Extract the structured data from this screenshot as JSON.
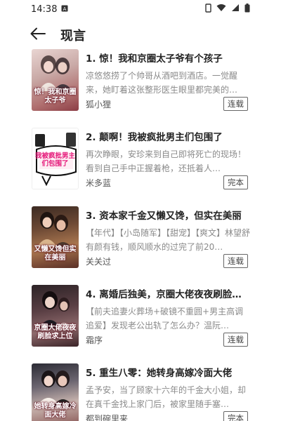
{
  "status_bar": {
    "time": "14:38",
    "icons": [
      "notification-a-icon",
      "sim-icon",
      "wifi-icon",
      "signal-icon",
      "battery-icon"
    ]
  },
  "header": {
    "back_icon": "arrow-left-icon",
    "title": "现言"
  },
  "books": [
    {
      "title": "1. 惊！我和京圈太子爷有个孩子",
      "description": "凉悠悠捞了个帅哥从酒吧到酒店。一觉醒来，她盯着这张整形医生眼里都完美的…",
      "author": "狐小狸",
      "status": "连载",
      "cover_text": "惊！我和京圈太子爷"
    },
    {
      "title": "2. 颠啊！我被疯批男主们包围了",
      "description": "再次睁眼，安珍来到自己即将死亡的现场！看到自己手中正握着枪，还抵着人…",
      "author": "米多蓝",
      "status": "完本",
      "cover_text": "我被疯批男主们包围了"
    },
    {
      "title": "3. 资本家千金又懒又馋，但实在美丽",
      "description": "【年代】【小岛随军】【甜宠】【爽文】林望舒有颜有钱，顺风顺水的过完了前20…",
      "author": "关关过",
      "status": "连载",
      "cover_text": "又懒又馋但实在美丽"
    },
    {
      "title": "4. 离婚后独美，京圈大佬夜夜刷脸…",
      "description": "【前夫追妻火葬场+破镜不重圆+男主高调追爱】发现老公出轨了怎么办？温阮…",
      "author": "霜序",
      "status": "连载",
      "cover_text": "京圈大佬夜夜刷脸求上位"
    },
    {
      "title": "5. 重生八零：她转身高嫁冷面大佬",
      "description": "孟予安，当了顾家十六年的千金大小姐，却在真千金找上家门后，被家里随手塞…",
      "author": "都到碗里来",
      "status": "完本",
      "cover_text": "她转身高嫁冷面大佬"
    }
  ],
  "colors": {
    "background": "#ffffff",
    "title_text": "#222222",
    "description_text": "#8a8a8a",
    "status_border": "#666666"
  }
}
